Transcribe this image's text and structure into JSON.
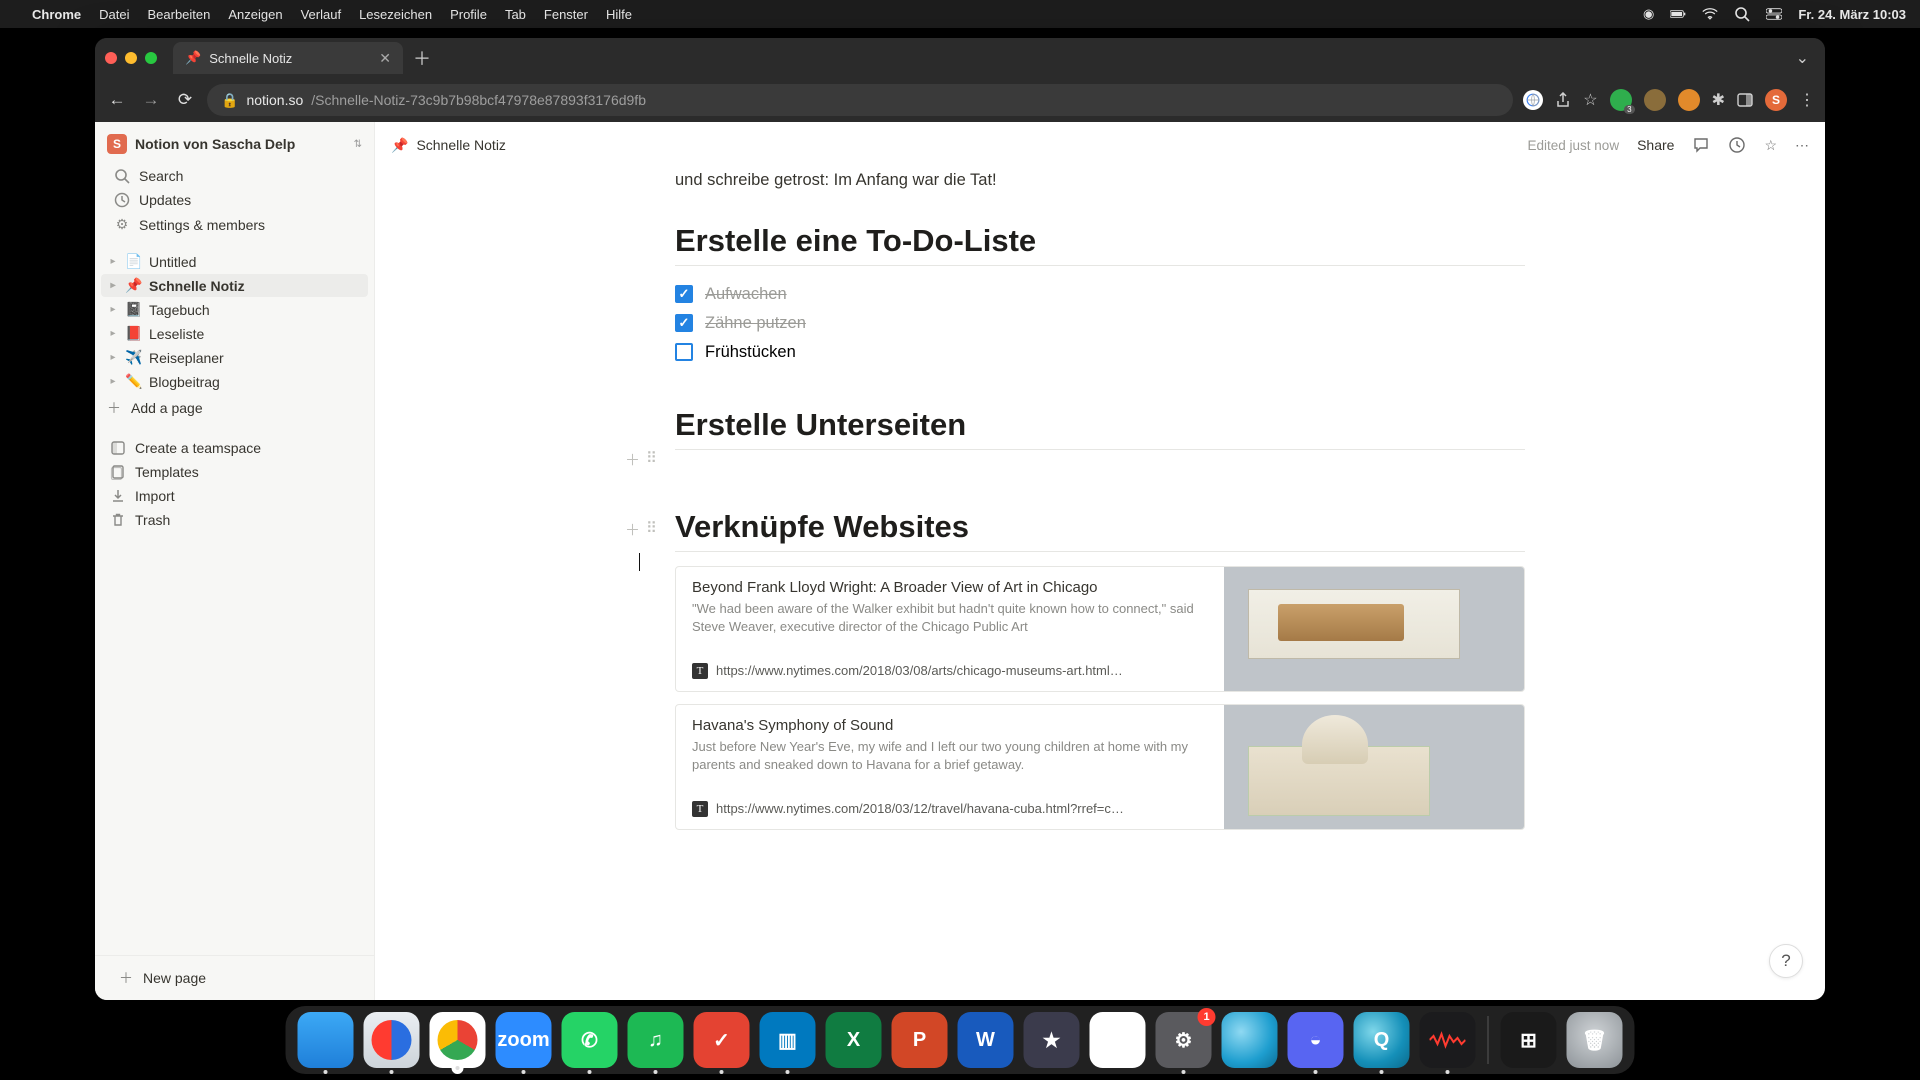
{
  "mac_menu": {
    "app": "Chrome",
    "items": [
      "Datei",
      "Bearbeiten",
      "Anzeigen",
      "Verlauf",
      "Lesezeichen",
      "Profile",
      "Tab",
      "Fenster",
      "Hilfe"
    ],
    "clock": "Fr. 24. März  10:03"
  },
  "browser": {
    "tab_title": "Schnelle Notiz",
    "url_domain": "notion.so",
    "url_path": "/Schnelle-Notiz-73c9b7b98bcf47978e87893f3176d9fb"
  },
  "notion": {
    "workspace": {
      "badge": "S",
      "name": "Notion von Sascha Delp"
    },
    "sidebar_top": [
      {
        "icon": "search",
        "label": "Search"
      },
      {
        "icon": "clock",
        "label": "Updates"
      },
      {
        "icon": "gear",
        "label": "Settings & members"
      }
    ],
    "pages": [
      {
        "emoji": "📄",
        "label": "Untitled",
        "active": false
      },
      {
        "emoji": "📌",
        "label": "Schnelle Notiz",
        "active": true
      },
      {
        "emoji": "📓",
        "label": "Tagebuch",
        "active": false
      },
      {
        "emoji": "📕",
        "label": "Leseliste",
        "active": false
      },
      {
        "emoji": "✈️",
        "label": "Reiseplaner",
        "active": false
      },
      {
        "emoji": "✏️",
        "label": "Blogbeitrag",
        "active": false
      }
    ],
    "add_page": "Add a page",
    "sidebar_bottom": [
      {
        "icon": "teamspace",
        "label": "Create a teamspace"
      },
      {
        "icon": "templates",
        "label": "Templates"
      },
      {
        "icon": "import",
        "label": "Import"
      },
      {
        "icon": "trash",
        "label": "Trash"
      }
    ],
    "new_page": "New page",
    "topbar": {
      "title": "Schnelle Notiz",
      "edited": "Edited just now",
      "share": "Share"
    },
    "content": {
      "intro_para": "und schreibe getrost: Im Anfang war die Tat!",
      "h1": "Erstelle eine To-Do-Liste",
      "todos": [
        {
          "label": "Aufwachen",
          "done": true
        },
        {
          "label": "Zähne putzen",
          "done": true
        },
        {
          "label": "Frühstücken",
          "done": false
        }
      ],
      "h2": "Erstelle Unterseiten",
      "h3": "Verknüpfe Websites",
      "bookmarks": [
        {
          "title": "Beyond Frank Lloyd Wright: A Broader View of Art in Chicago",
          "desc": "\"We had been aware of the Walker exhibit but hadn't quite known how to connect,\" said Steve Weaver, executive director of the Chicago Public Art",
          "url": "https://www.nytimes.com/2018/03/08/arts/chicago-museums-art.html…",
          "fav": "T",
          "img": "chicago"
        },
        {
          "title": "Havana's Symphony of Sound",
          "desc": "Just before New Year's Eve, my wife and I left our two young children at home with my parents and sneaked down to Havana for a brief getaway.",
          "url": "https://www.nytimes.com/2018/03/12/travel/havana-cuba.html?rref=c…",
          "fav": "T",
          "img": "havana"
        }
      ]
    }
  },
  "dock": {
    "apps": [
      {
        "name": "finder",
        "label": "",
        "running": true
      },
      {
        "name": "safari",
        "label": "",
        "running": true
      },
      {
        "name": "chrome-app",
        "label": "",
        "running": true
      },
      {
        "name": "zoom",
        "label": "zoom",
        "running": true
      },
      {
        "name": "whatsapp",
        "label": "",
        "running": true
      },
      {
        "name": "spotify",
        "label": "",
        "running": true
      },
      {
        "name": "todoist",
        "label": "✓",
        "running": true
      },
      {
        "name": "trello",
        "label": "",
        "running": true
      },
      {
        "name": "excel",
        "label": "X",
        "running": false
      },
      {
        "name": "ppt",
        "label": "P",
        "running": false
      },
      {
        "name": "word",
        "label": "W",
        "running": false
      },
      {
        "name": "imovie",
        "label": "★",
        "running": false
      },
      {
        "name": "drive",
        "label": "▲",
        "running": false
      },
      {
        "name": "settings",
        "label": "⚙",
        "running": true,
        "badge": "1"
      },
      {
        "name": "globe",
        "label": "",
        "running": false
      },
      {
        "name": "discord",
        "label": "",
        "running": true
      },
      {
        "name": "quicktime",
        "label": "Q",
        "running": true
      },
      {
        "name": "voicememo",
        "label": "",
        "running": true
      }
    ],
    "apps_right": [
      {
        "name": "immersed",
        "label": ""
      },
      {
        "name": "trash",
        "label": ""
      }
    ]
  }
}
